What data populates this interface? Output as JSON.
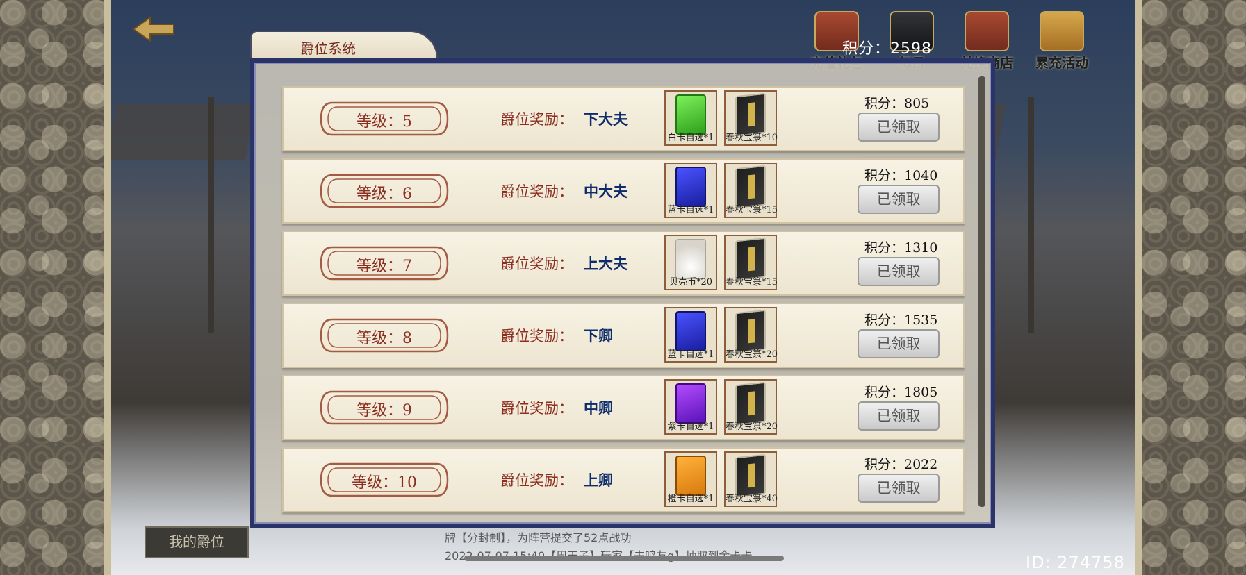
{
  "top": {
    "score_text": "积分：2598",
    "tabs": [
      {
        "label": "充值礼包"
      },
      {
        "label": "每日"
      },
      {
        "label": "兑换商店"
      },
      {
        "label": "累充活动"
      }
    ]
  },
  "panel": {
    "title": "爵位系统",
    "rows": [
      {
        "level": "等级：5",
        "reward_label": "爵位奖励：",
        "reward_title": "下大夫",
        "item1": "白卡自选*1",
        "item2": "春秋宝箓*10",
        "score": "积分：805",
        "button": "已领取"
      },
      {
        "level": "等级：6",
        "reward_label": "爵位奖励：",
        "reward_title": "中大夫",
        "item1": "蓝卡自选*1",
        "item2": "春秋宝箓*15",
        "score": "积分：1040",
        "button": "已领取"
      },
      {
        "level": "等级：7",
        "reward_label": "爵位奖励：",
        "reward_title": "上大夫",
        "item1": "贝壳币*20",
        "item2": "春秋宝箓*15",
        "score": "积分：1310",
        "button": "已领取"
      },
      {
        "level": "等级：8",
        "reward_label": "爵位奖励：",
        "reward_title": "下卿",
        "item1": "蓝卡自选*1",
        "item2": "春秋宝箓*20",
        "score": "积分：1535",
        "button": "已领取"
      },
      {
        "level": "等级：9",
        "reward_label": "爵位奖励：",
        "reward_title": "中卿",
        "item1": "紫卡自选*1",
        "item2": "春秋宝箓*20",
        "score": "积分：1805",
        "button": "已领取"
      },
      {
        "level": "等级：10",
        "reward_label": "爵位奖励：",
        "reward_title": "上卿",
        "item1": "橙卡自选*1",
        "item2": "春秋宝箓*40",
        "score": "积分：2022",
        "button": "已领取"
      }
    ]
  },
  "bottom": {
    "my_rank": "我的爵位",
    "log_lines": [
      "牌【分封制】，为阵营提交了52点战功",
      "2022-07-07 15:40【周天子】玩家【夫鸣友g】抽取到金卡卡"
    ],
    "id_text": "ID: 274758"
  },
  "colors": {
    "frame": "#2b3468",
    "label_red": "#8b2e20",
    "title_blue": "#0d2c6a"
  }
}
